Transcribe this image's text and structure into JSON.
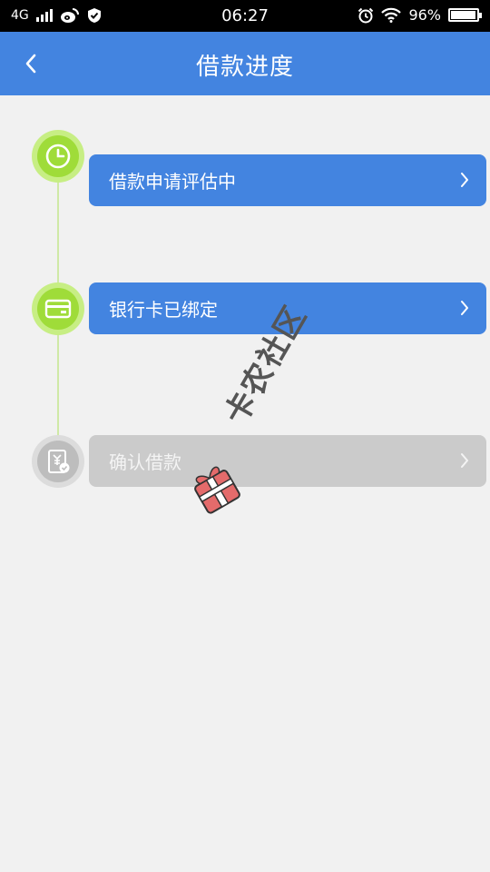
{
  "status_bar": {
    "network": "4G",
    "time": "06:27",
    "battery": "96%",
    "battery_level": 0.96
  },
  "header": {
    "back_icon": "chevron-left-icon",
    "title": "借款进度"
  },
  "steps": [
    {
      "label": "借款申请评估中",
      "state": "active",
      "icon": "clock-icon"
    },
    {
      "label": "银行卡已绑定",
      "state": "active",
      "icon": "card-icon"
    },
    {
      "label": "确认借款",
      "state": "inactive",
      "icon": "confirm-yuan-icon"
    }
  ],
  "watermark": {
    "text": "卡农社区",
    "logo": "gift-logo-icon"
  },
  "colors": {
    "header": "#4384e0",
    "active_step": "#4384e0",
    "inactive_step": "#cbcbcb",
    "node_active": "#9fdc39",
    "node_inactive": "#bdbdbd",
    "background": "#f1f1f1"
  }
}
